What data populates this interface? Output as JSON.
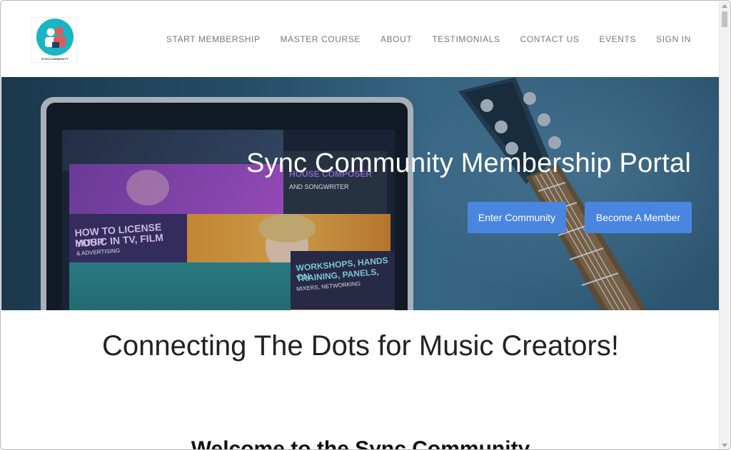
{
  "logo": {
    "text": "SYNCCOMMUNITY",
    "icon": "people-circle-logo"
  },
  "nav": {
    "items": [
      {
        "label": "START MEMBERSHIP"
      },
      {
        "label": "MASTER COURSE"
      },
      {
        "label": "ABOUT"
      },
      {
        "label": "TESTIMONIALS"
      },
      {
        "label": "CONTACT US"
      },
      {
        "label": "EVENTS"
      },
      {
        "label": "SIGN IN"
      }
    ]
  },
  "hero": {
    "title": "Sync Community Membership Portal",
    "enter_button": "Enter Community",
    "member_button": "Become A Member",
    "screen": {
      "house_composer": "HOUSE COMPOSER",
      "songwriter": "AND SONGWRITER",
      "license_line1": "HOW TO LICENSE YOUR",
      "license_line2": "MUSIC IN TV, FILM",
      "advertising": "& ADVERTISING",
      "workshops_line1": "WORKSHOPS, HANDS ON",
      "workshops_line2": "TRAINING, PANELS,",
      "mixers": "MIXERS, NETWORKING"
    }
  },
  "content": {
    "tagline": "Connecting The Dots for Music Creators!",
    "welcome": "Welcome to the Sync Community"
  },
  "colors": {
    "button_blue": "#4a86e0",
    "nav_text": "#777777",
    "logo_teal": "#19b5c4",
    "logo_red": "#e05a5a"
  }
}
